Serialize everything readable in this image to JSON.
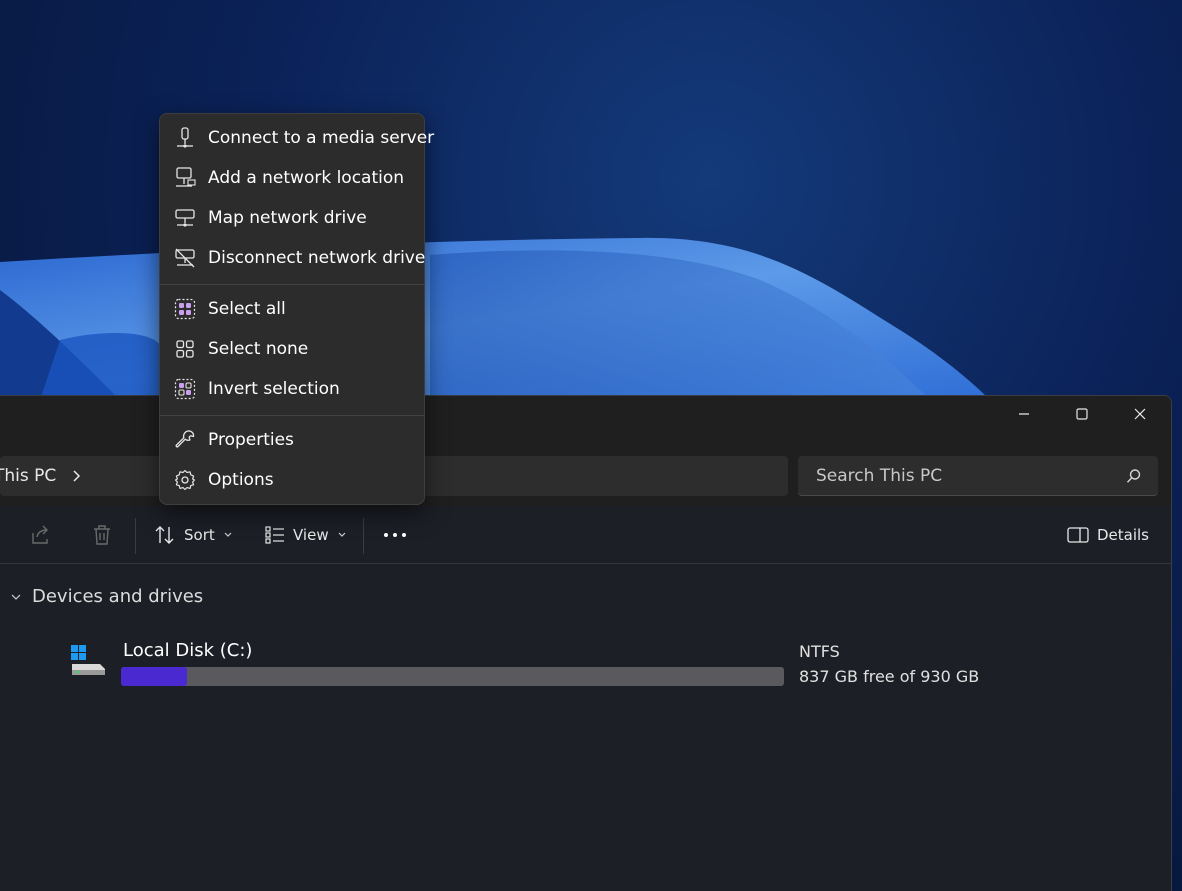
{
  "menu": {
    "items": [
      {
        "label": "Connect to a media server",
        "icon": "media-server-icon"
      },
      {
        "label": "Add a network location",
        "icon": "network-location-icon"
      },
      {
        "label": "Map network drive",
        "icon": "map-drive-icon"
      },
      {
        "label": "Disconnect network drive",
        "icon": "disconnect-drive-icon"
      },
      {
        "label": "Select all",
        "icon": "select-all-icon"
      },
      {
        "label": "Select none",
        "icon": "select-none-icon"
      },
      {
        "label": "Invert selection",
        "icon": "invert-selection-icon"
      },
      {
        "label": "Properties",
        "icon": "wrench-icon"
      },
      {
        "label": "Options",
        "icon": "gear-icon"
      }
    ]
  },
  "address": {
    "breadcrumb": "This PC",
    "search_placeholder": "Search This PC"
  },
  "toolbar": {
    "sort_label": "Sort",
    "view_label": "View",
    "details_label": "Details"
  },
  "content": {
    "group_title": "Devices and drives",
    "drive": {
      "name": "Local Disk (C:)",
      "filesystem": "NTFS",
      "space": "837 GB free of 930 GB",
      "used_fraction": 0.1
    }
  },
  "colors": {
    "accent": "#4a2ad0",
    "window_bg": "#1c1f26",
    "menu_bg": "#2c2c2c"
  }
}
